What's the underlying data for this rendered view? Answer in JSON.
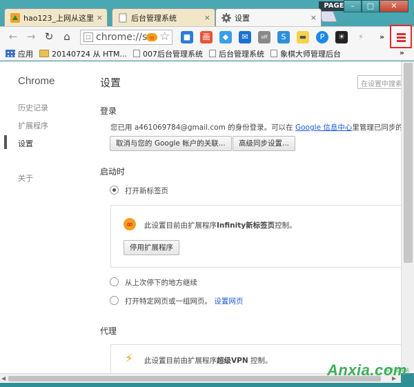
{
  "window": {
    "page_label": "PAGE",
    "minimize": "–",
    "maximize": "□",
    "close": "✕"
  },
  "tabs": [
    {
      "label": "hao123_上网从这里",
      "close": "×"
    },
    {
      "label": "后台管理系统",
      "close": "×"
    },
    {
      "label": "设置",
      "close": "×"
    }
  ],
  "toolbar": {
    "url": "chrome://s",
    "star": "☆",
    "more_extensions": "»",
    "extensions": [
      {
        "name": "extension-icon",
        "color": "#2e7bd6",
        "glyph": "■"
      },
      {
        "name": "extension-icon",
        "color": "#e8553b",
        "glyph": "画"
      },
      {
        "name": "extension-icon",
        "color": "#3a9fe8",
        "glyph": "◆"
      },
      {
        "name": "extension-icon",
        "color": "#1c72d0",
        "glyph": "✉"
      },
      {
        "name": "extension-icon",
        "color": "#888888",
        "glyph": "off"
      },
      {
        "name": "extension-icon",
        "color": "#2f8fd8",
        "glyph": "S"
      },
      {
        "name": "extension-icon",
        "color": "#f6d34a",
        "glyph": "▬"
      },
      {
        "name": "extension-icon",
        "color": "#1e88e5",
        "glyph": "P"
      },
      {
        "name": "extension-icon",
        "color": "#222222",
        "glyph": "☀"
      },
      {
        "name": "extension-icon",
        "color": "#aaaaaa",
        "glyph": "⚡"
      }
    ]
  },
  "bookmarks": {
    "items": [
      {
        "label": "应用",
        "icon": "grid"
      },
      {
        "label": "20140724 从 HTM...",
        "icon": "folder"
      },
      {
        "label": "007后台管理系统",
        "icon": "page"
      },
      {
        "label": "后台管理系统",
        "icon": "page"
      },
      {
        "label": "象棋大师管理后台",
        "icon": "page"
      }
    ],
    "more": "»"
  },
  "sidebar": {
    "title": "Chrome",
    "items": [
      "历史记录",
      "扩展程序",
      "设置",
      "关于"
    ]
  },
  "main": {
    "title": "设置",
    "search_placeholder": "在设置中搜索",
    "signin": {
      "heading": "登录",
      "text_before": "您已用 a461069784@gmail.com 的身份登录。可以在 ",
      "link": "Google 信息中心",
      "text_after": "里管理已同步的数",
      "disconnect_button": "取消与您的 Google 帐户的关联...",
      "advanced_sync_button": "高级同步设置..."
    },
    "startup": {
      "heading": "启动时",
      "option_new_tab": "打开新标签页",
      "ext_notice_prefix": "此设置目前由扩展程序",
      "ext_notice_name": "Infinity新标签页",
      "ext_notice_suffix": "控制。",
      "disable_button": "停用扩展程序",
      "option_continue": "从上次停下的地方继续",
      "option_pages": "打开特定网页或一组网页。",
      "set_pages_link": "设置网页"
    },
    "proxy": {
      "heading": "代理",
      "notice_prefix": "此设置目前由扩展程序",
      "notice_name": "超级VPN",
      "notice_suffix": " 控制。"
    }
  },
  "watermark": {
    "text": "Anxia.com",
    "sub": "安下软件站"
  },
  "colors": {
    "menu_highlight": "#e32b2b",
    "link": "#1a5bd6"
  }
}
